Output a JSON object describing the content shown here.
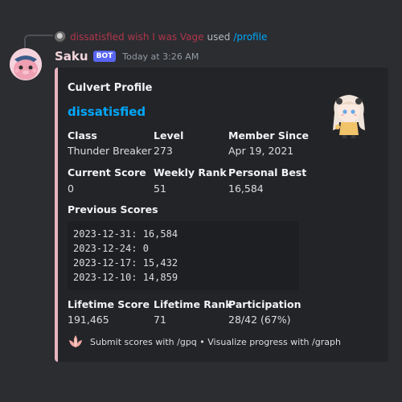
{
  "reply": {
    "username": "dissatisfied wish I was Vage",
    "used_text": "used",
    "command": "/profile"
  },
  "author": {
    "name": "Saku",
    "bot_tag": "BOT",
    "timestamp": "Today at 3:26 AM"
  },
  "embed": {
    "accent_color": "#e8b4bf",
    "title": "Culvert Profile",
    "username": "dissatisfied",
    "fields": {
      "class": {
        "name": "Class",
        "value": "Thunder Breaker"
      },
      "level": {
        "name": "Level",
        "value": "273"
      },
      "member_since": {
        "name": "Member Since",
        "value": "Apr 19, 2021"
      },
      "current_score": {
        "name": "Current Score",
        "value": "0"
      },
      "weekly_rank": {
        "name": "Weekly Rank",
        "value": "51"
      },
      "personal_best": {
        "name": "Personal Best",
        "value": "16,584"
      },
      "previous_scores": {
        "name": "Previous Scores"
      },
      "lifetime_score": {
        "name": "Lifetime Score",
        "value": "191,465"
      },
      "lifetime_rank": {
        "name": "Lifetime Rank",
        "value": "71"
      },
      "participation": {
        "name": "Participation",
        "value": "28/42 (67%)"
      }
    },
    "previous_scores_lines": [
      "2023-12-31: 16,584",
      "2023-12-24: 0",
      "2023-12-17: 15,432",
      "2023-12-10: 14,859"
    ],
    "footer_text": "Submit scores with /gpq • Visualize progress with /graph",
    "footer_icon": "flower-icon",
    "thumbnail_icon": "chibi-character-icon"
  }
}
